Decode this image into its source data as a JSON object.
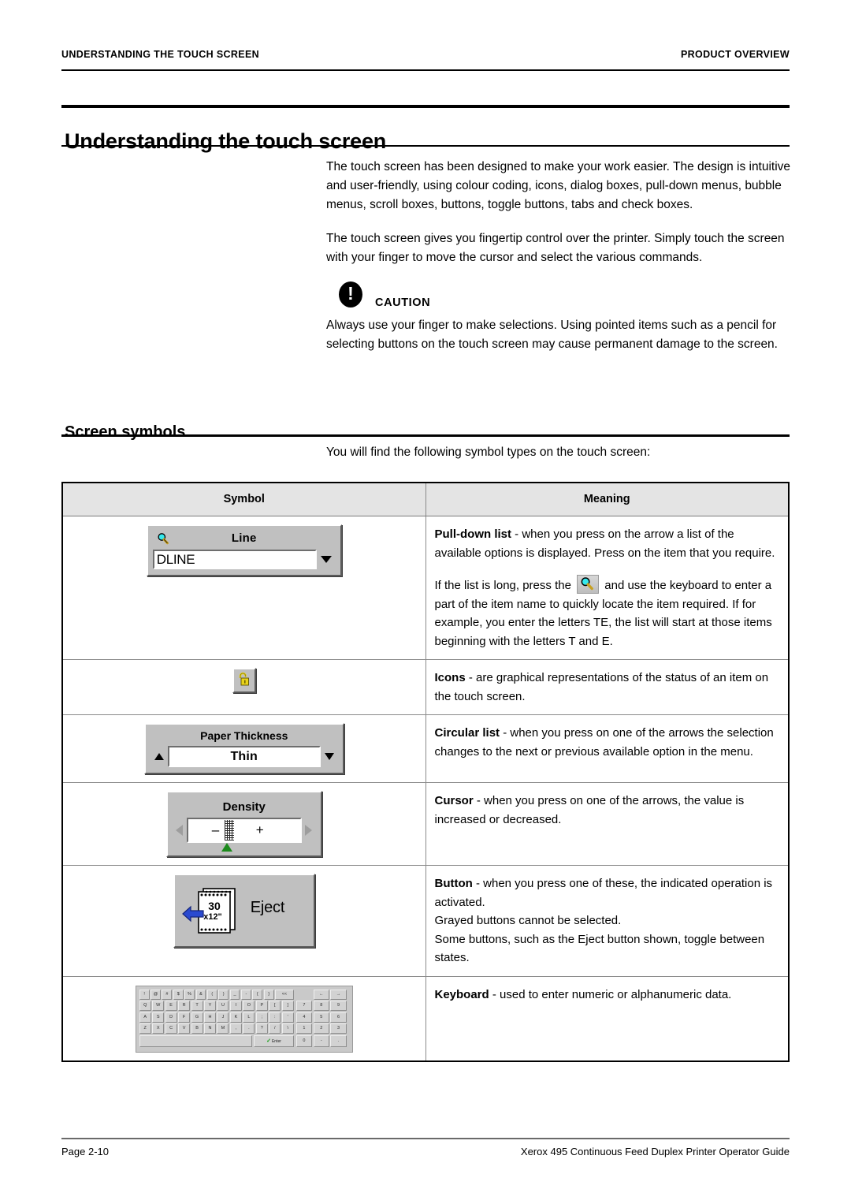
{
  "header": {
    "left": "UNDERSTANDING THE TOUCH SCREEN",
    "right": "PRODUCT OVERVIEW"
  },
  "chapter_title": "Understanding the touch screen",
  "intro": {
    "paragraph_1": "The touch screen has been designed to make your work easier. The design is intuitive and user-friendly, using colour coding, icons, dialog boxes, pull-down menus, bubble menus, scroll boxes, buttons, toggle buttons, tabs and check boxes.",
    "paragraph_2": "The touch screen gives you fingertip control over the printer. Simply touch the screen with your finger to move the cursor and select the various commands."
  },
  "caution": {
    "glyph": "!",
    "label": "CAUTION",
    "text": "Always use your finger to make selections. Using pointed items such as a pencil for selecting buttons on the touch screen may cause permanent damage to the screen."
  },
  "section": {
    "title": "Screen symbols",
    "intro": "You will find the following symbol types on the touch screen:"
  },
  "table": {
    "columns": [
      "Symbol",
      "Meaning"
    ],
    "rows": [
      {
        "symbol_kind": "pull-down-list",
        "widget": {
          "caption": "Line",
          "value": "DLINE",
          "icon": "magnifier-icon",
          "arrow": "chevron-down-icon"
        },
        "meaning_paragraphs": [
          {
            "lead": "Pull-down list",
            "rest": " - when you press on the arrow a list of the available options is displayed. Press on the item that you require."
          }
        ],
        "meaning_inline": {
          "before": "If the list is long, press the ",
          "after": " and use the keyboard to enter a part of the item name to quickly locate the item required. If for example, you enter the letters TE, the list will start at those items beginning with the letters T and E."
        }
      },
      {
        "symbol_kind": "icon-button",
        "widget": {
          "icon": "padlock-icon"
        },
        "meaning_paragraphs": [
          {
            "lead": "Icons",
            "rest": " - are graphical representations of the status of an item on the touch screen."
          }
        ]
      },
      {
        "symbol_kind": "circular-list",
        "widget": {
          "caption": "Paper Thickness",
          "value": "Thin",
          "up_arrow": "chevron-up-icon",
          "down_arrow": "chevron-down-icon"
        },
        "meaning_paragraphs": [
          {
            "lead": "Circular list",
            "rest": " - when you press on one of the arrows the selection changes to the next or previous available option in the menu."
          }
        ]
      },
      {
        "symbol_kind": "cursor-slider",
        "widget": {
          "caption": "Density",
          "minus": "–",
          "plus": "+",
          "left_arrow": "triangle-left-icon",
          "right_arrow": "triangle-right-icon",
          "marker": "green-marker-icon"
        },
        "meaning_paragraphs": [
          {
            "lead": "Cursor",
            "rest": " - when you press on one of the arrows, the value is increased or decreased."
          }
        ]
      },
      {
        "symbol_kind": "button",
        "widget": {
          "label": "Eject",
          "icon": "fanfold-paper-icon",
          "paper_size_line1": "30",
          "paper_size_line2": "x12\"",
          "arrow": "blue-left-arrow-icon"
        },
        "meaning_paragraphs": [
          {
            "lead": "Button",
            "rest": " - when you press one of these, the indicated operation is activated."
          },
          {
            "lead": "",
            "rest": "Grayed buttons cannot be selected."
          },
          {
            "lead": "",
            "rest": "Some buttons, such as the Eject button shown, toggle between states."
          }
        ]
      },
      {
        "symbol_kind": "keyboard",
        "widget": {
          "rows": [
            [
              "!",
              "@",
              "#",
              "$",
              "%",
              "&",
              "(",
              ")",
              "_",
              "-",
              "{",
              "}",
              "<<"
            ],
            [
              "Q",
              "W",
              "E",
              "R",
              "T",
              "Y",
              "U",
              "I",
              "O",
              "P",
              "[",
              "]"
            ],
            [
              "A",
              "S",
              "D",
              "F",
              "G",
              "H",
              "J",
              "K",
              "L",
              ";",
              ":",
              "'"
            ],
            [
              "Z",
              "X",
              "C",
              "V",
              "B",
              "N",
              "M",
              ",",
              ".",
              "?",
              "/",
              "\\"
            ]
          ],
          "space_label": "",
          "enter_label": "Enter",
          "enter_check": "✓",
          "numpad_rows": [
            [
              "←",
              "→"
            ],
            [
              "7",
              "8",
              "9"
            ],
            [
              "4",
              "5",
              "6"
            ],
            [
              "1",
              "2",
              "3"
            ],
            [
              "0",
              "-",
              "."
            ]
          ]
        },
        "meaning_paragraphs": [
          {
            "lead": "Keyboard",
            "rest": " - used to enter numeric or alphanumeric data."
          }
        ]
      }
    ]
  },
  "footer": {
    "page": "Page 2-10",
    "guide": "Xerox 495 Continuous Feed Duplex Printer Operator Guide"
  },
  "colors": {
    "magnifier_lens": "#35e8ec",
    "magnifier_handle": "#c8a020",
    "padlock": "#e8d21a",
    "green_marker": "#1c8a1c",
    "blue_arrow": "#2a4ad0",
    "table_header_bg": "#e4e4e4",
    "widget_face": "#c0c0c0"
  }
}
